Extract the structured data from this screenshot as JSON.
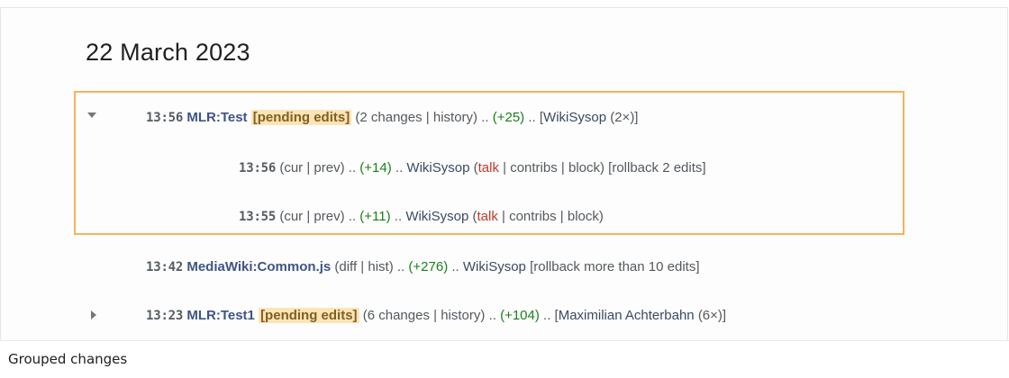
{
  "heading": "22 March 2023",
  "caption": "Grouped changes",
  "grouped": {
    "time": "13:56",
    "page": "MLR:Test",
    "pending": "[pending edits]",
    "changes": "(2 changes",
    "sep": "|",
    "history": "history)",
    "dots1": "..",
    "diff": "(+25)",
    "dots2": "..",
    "users_open": "[",
    "user": "WikiSysop",
    "count": "(2×)]"
  },
  "sub1": {
    "time": "13:56",
    "cur": "(cur",
    "sep": "|",
    "prev": "prev)",
    "dots1": "..",
    "diff": "(+14)",
    "dots2": "..",
    "user": "WikiSysop",
    "talk_open": "(",
    "talk": "talk",
    "sep2": "|",
    "contribs": "contribs",
    "sep3": "|",
    "block": "block)",
    "rollback": "[rollback 2 edits]"
  },
  "sub2": {
    "time": "13:55",
    "cur": "(cur",
    "sep": "|",
    "prev": "prev)",
    "dots1": "..",
    "diff": "(+11)",
    "dots2": "..",
    "user": "WikiSysop",
    "talk_open": "(",
    "talk": "talk",
    "sep2": "|",
    "contribs": "contribs",
    "sep3": "|",
    "block": "block)"
  },
  "single": {
    "time": "13:42",
    "page": "MediaWiki:Common.js",
    "diff_open": "(diff",
    "sep": "|",
    "hist": "hist)",
    "dots1": "..",
    "diff": "(+276)",
    "dots2": "..",
    "user": "WikiSysop",
    "rollback": "[rollback more than 10 edits]"
  },
  "collapsed": {
    "time": "13:23",
    "page": "MLR:Test1",
    "pending": "[pending edits]",
    "changes": "(6 changes",
    "sep": "|",
    "history": "history)",
    "dots1": "..",
    "diff": "(+104)",
    "dots2": "..",
    "users_open": "[",
    "user": "Maximilian Achterbahn",
    "count": "(6×)]"
  },
  "colors": {
    "highlight_border": "#f6b25c",
    "pending_bg": "#fce4b6",
    "positive_diff": "#1a7f1a",
    "talk_link": "#c0392b",
    "page_link": "#3f5485"
  }
}
